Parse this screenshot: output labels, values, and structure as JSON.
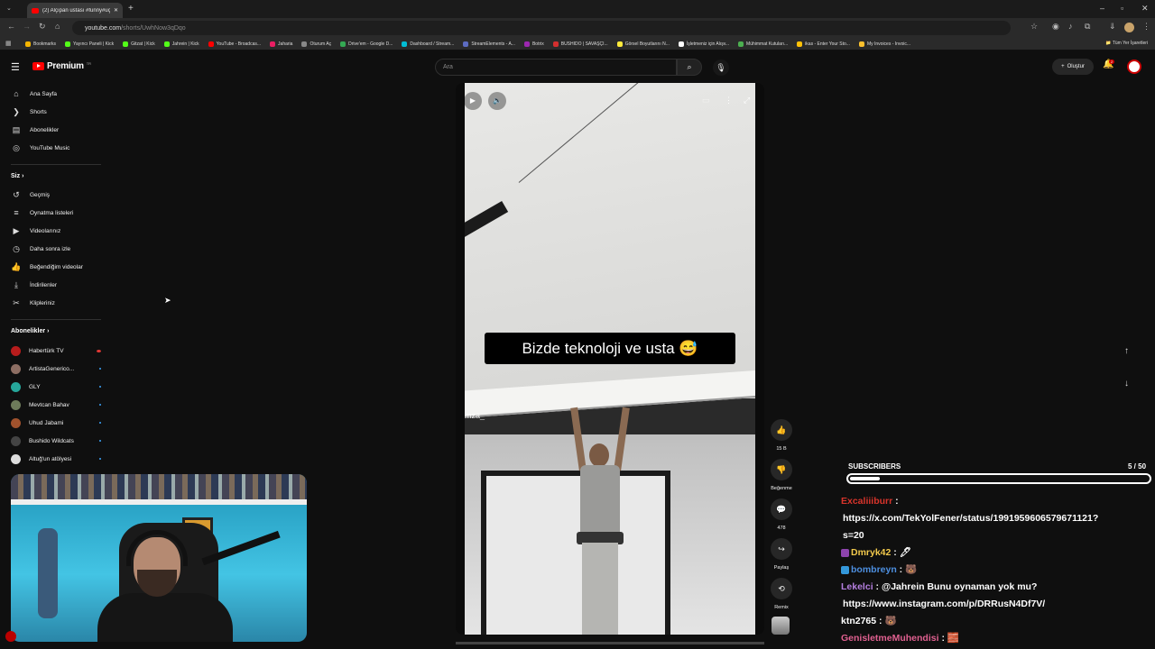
{
  "browser": {
    "tab_title": "(2) Alçıpan ustası #funny#uçak",
    "url_host": "youtube.com",
    "url_path": "/shorts/UwhNow3qDqo",
    "all_bookmarks": "Tüm Yer İşaretleri",
    "bookmarks": [
      {
        "label": "Bookmarks",
        "color": "#f4b400"
      },
      {
        "label": "Yayıncı Paneli | Kick",
        "color": "#53fc18"
      },
      {
        "label": "Gitzat | Kick",
        "color": "#53fc18"
      },
      {
        "label": "Jahrein | Kick",
        "color": "#53fc18"
      },
      {
        "label": "YouTube - Broadcas...",
        "color": "#ff0000"
      },
      {
        "label": "Jaharia",
        "color": "#e91e63"
      },
      {
        "label": "Oturum Aç",
        "color": "#888888"
      },
      {
        "label": "Drive'em - Google D...",
        "color": "#34a853"
      },
      {
        "label": "Dashboard / Stream...",
        "color": "#00bcd4"
      },
      {
        "label": "StreamElements - A...",
        "color": "#5c6bc0"
      },
      {
        "label": "Botrix",
        "color": "#9c27b0"
      },
      {
        "label": "BUSHIDO | SAVAŞÇI...",
        "color": "#d32f2f"
      },
      {
        "label": "Görsel Boyutlarını N...",
        "color": "#ffeb3b"
      },
      {
        "label": "İşletmeniz için Alışv...",
        "color": "#ffffff"
      },
      {
        "label": "Mühimmat Kutuları...",
        "color": "#4caf50"
      },
      {
        "label": "ikas - Enter Your Sto...",
        "color": "#ffc107"
      },
      {
        "label": "My Invoices - Invoic...",
        "color": "#fbc02d"
      }
    ]
  },
  "youtube": {
    "logo_text": "Premium",
    "logo_region": "TR",
    "search_placeholder": "Ara",
    "create_label": "Oluştur",
    "notif_count": "2",
    "sidebar": {
      "main": [
        {
          "label": "Ana Sayfa",
          "icon": "home-icon"
        },
        {
          "label": "Shorts",
          "icon": "shorts-icon"
        },
        {
          "label": "Abonelikler",
          "icon": "subscriptions-icon"
        },
        {
          "label": "YouTube Music",
          "icon": "music-icon"
        }
      ],
      "you_heading": "Siz",
      "you": [
        {
          "label": "Geçmiş",
          "icon": "history-icon"
        },
        {
          "label": "Oynatma listeleri",
          "icon": "playlist-icon"
        },
        {
          "label": "Videolarınız",
          "icon": "your-videos-icon"
        },
        {
          "label": "Daha sonra izle",
          "icon": "watch-later-icon"
        },
        {
          "label": "Beğendiğim videolar",
          "icon": "liked-icon"
        },
        {
          "label": "İndirilenler",
          "icon": "download-icon"
        },
        {
          "label": "Klipleriniz",
          "icon": "clips-icon"
        }
      ],
      "subs_heading": "Abonelikler",
      "subs": [
        {
          "label": "Habertürk TV",
          "color": "#b71c1c",
          "live": true
        },
        {
          "label": "ArtistaGenerico...",
          "color": "#8d6e63",
          "live": false
        },
        {
          "label": "GLY",
          "color": "#26a69a",
          "live": false
        },
        {
          "label": "Mevtcan Bahav",
          "color": "#6d7b5a",
          "live": false
        },
        {
          "label": "Uhud Jabami",
          "color": "#a0522d",
          "live": false
        },
        {
          "label": "Bushido Wildcats",
          "color": "#444444",
          "live": false
        },
        {
          "label": "Altuğ'un atölyesi",
          "color": "#dddddd",
          "live": false
        }
      ]
    },
    "short": {
      "caption": "Bizde teknoloji ve usta 😅",
      "watermark": "mza_",
      "actions": {
        "like_count": "15 B",
        "dislike_label": "Beğenme",
        "comment_count": "478",
        "share_label": "Paylaş",
        "remix_label": "Remix"
      }
    }
  },
  "overlay": {
    "subs_label": "SUBSCRIBERS",
    "subs_count": "5 / 50",
    "subs_progress": 0.1,
    "chat": [
      {
        "user": "Excaliiiburr",
        "color": "#d9342b",
        "text": "",
        "badge": ""
      },
      {
        "user": "",
        "color": "#ffffff",
        "text": "https://x.com/TekYolFener/status/1991959606579671121?",
        "badge": ""
      },
      {
        "user": "",
        "color": "#ffffff",
        "text": "s=20",
        "badge": ""
      },
      {
        "user": "Dmryk42",
        "color": "#f2c94c",
        "text": "🖊",
        "badge": "#8e44ad"
      },
      {
        "user": "bombreyn",
        "color": "#4d8fe0",
        "text": "🐻",
        "badge": "#3498db"
      },
      {
        "user": "Lekelci",
        "color": "#b57fe0",
        "text": "@Jahrein Bunu oynaman yok mu?",
        "badge": ""
      },
      {
        "user": "",
        "color": "#ffffff",
        "text": "https://www.instagram.com/p/DRRusN4Df7V/",
        "badge": ""
      },
      {
        "user": "ktn2765",
        "color": "#ffffff",
        "text": "🐻",
        "badge": ""
      },
      {
        "user": "GenisletmeMuhendisi",
        "color": "#e06090",
        "text": "🧱",
        "badge": ""
      }
    ]
  }
}
